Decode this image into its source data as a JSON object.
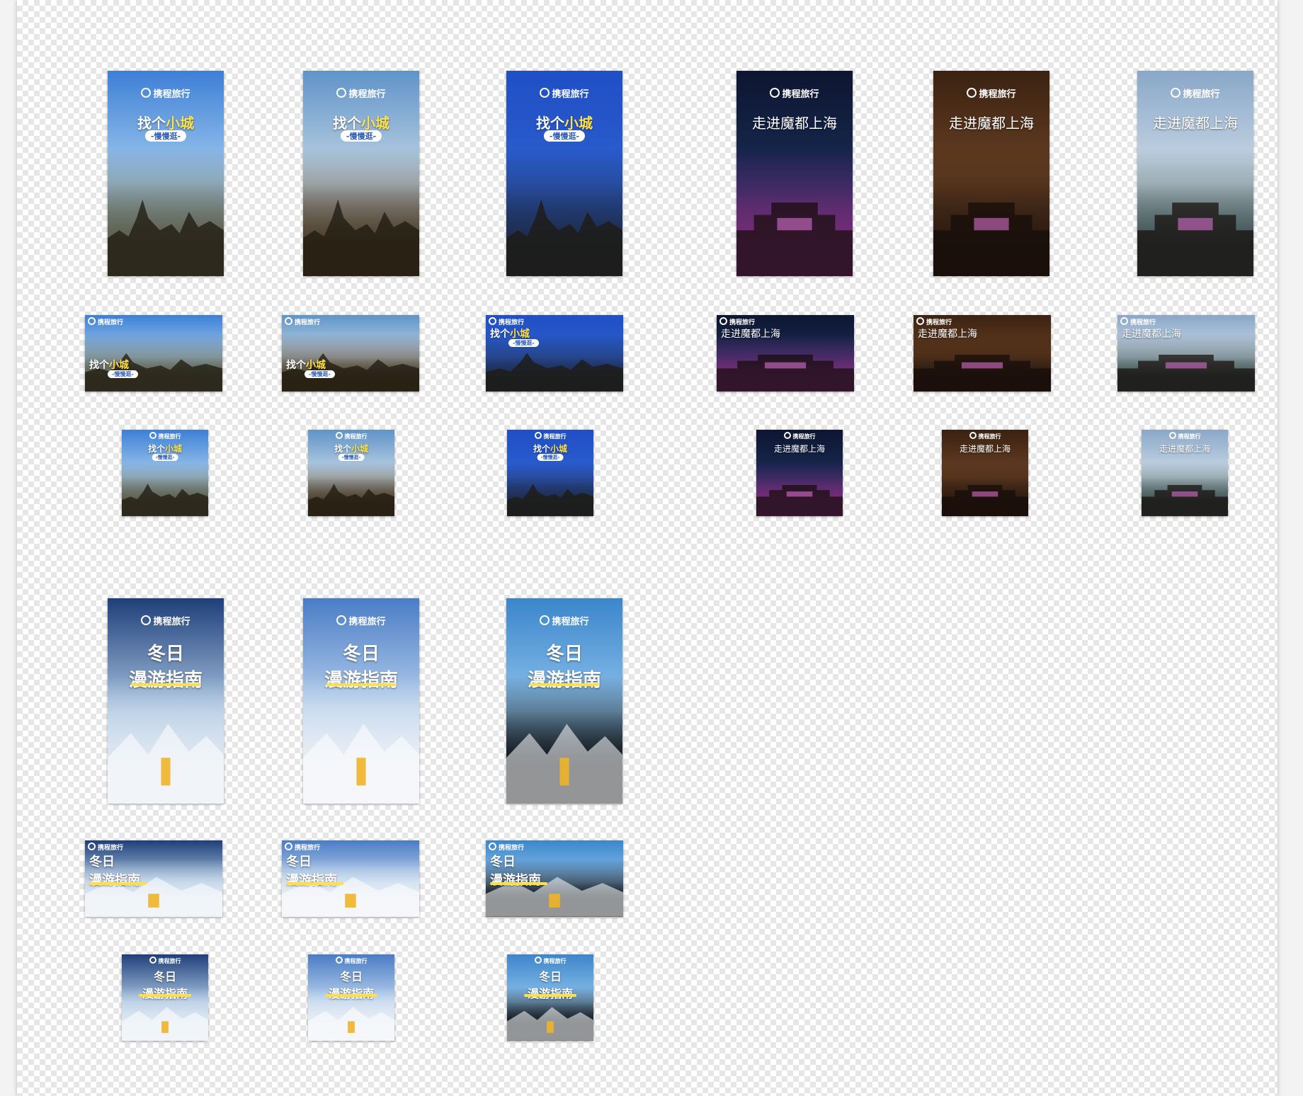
{
  "colors": {
    "ctrip_blue": "#2f6fd1",
    "gold_text": "#ffe04a",
    "canvas_check": "#e6e6e6"
  },
  "logo_text": "携程旅行",
  "groups": [
    {
      "name": "small-town",
      "headline_plain": "找个",
      "headline_highlight": "小城",
      "subtitle": "-慢慢逛-",
      "variants": [
        {
          "id": "pagoda",
          "sky": "#3d7fd6",
          "sky2": "#a6cdee",
          "scene": "#5b5a45"
        },
        {
          "id": "thai-temple",
          "sky": "#5f93c8",
          "sky2": "#c5d8e6",
          "scene": "#4b3a26"
        },
        {
          "id": "night-street",
          "sky": "#1f4fc4",
          "sky2": "#2d5fcf",
          "scene": "#1d2a48"
        }
      ]
    },
    {
      "name": "shanghai",
      "headline_plain": "走进魔都上海",
      "headline_highlight": "",
      "subtitle": "",
      "variants": [
        {
          "id": "disney-night",
          "sky": "#0d1630",
          "sky2": "#1a2a55",
          "scene": "#7a2c7a"
        },
        {
          "id": "peace-hotel",
          "sky": "#3a2212",
          "sky2": "#6b4124",
          "scene": "#2a1a10"
        },
        {
          "id": "quarry-hotel",
          "sky": "#8aa7c8",
          "sky2": "#cfdde9",
          "scene": "#3c5050"
        }
      ]
    },
    {
      "name": "winter",
      "headline_plain": "冬日",
      "headline_line2": "漫游指南",
      "subtitle": "",
      "variants": [
        {
          "id": "ski-mountain",
          "sky": "#1e3f7a",
          "sky2": "#a9c4e0",
          "scene": "#dfe8f2"
        },
        {
          "id": "family-snow",
          "sky": "#4a7cc6",
          "sky2": "#b9d2ec",
          "scene": "#e9eef4"
        },
        {
          "id": "window-dining",
          "sky": "#3b86cc",
          "sky2": "#8fc2ea",
          "scene": "#101418"
        }
      ]
    }
  ]
}
